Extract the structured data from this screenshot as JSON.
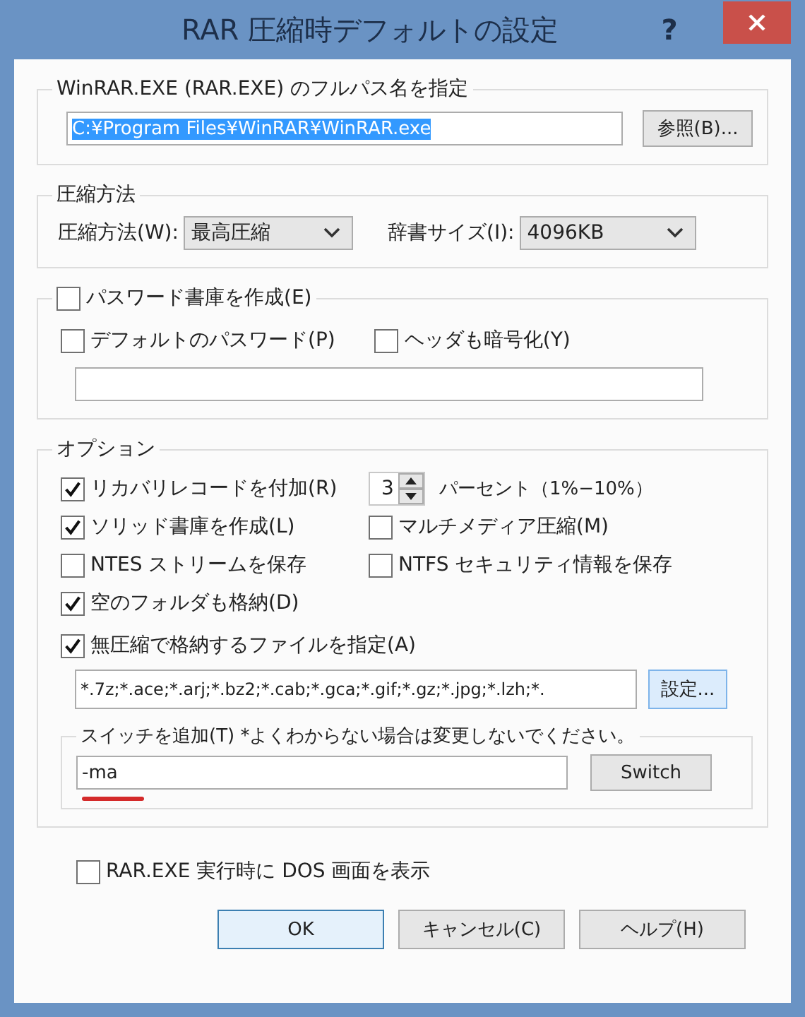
{
  "window": {
    "title": "RAR 圧縮時デフォルトの設定",
    "help": "?"
  },
  "path_group": {
    "label": "WinRAR.EXE (RAR.EXE) のフルパス名を指定",
    "value": "C:¥Program Files¥WinRAR¥WinRAR.exe",
    "selected": true,
    "browse_button": "参照(B)..."
  },
  "method_group": {
    "label": "圧縮方法",
    "method_label": "圧縮方法(W):",
    "method_value": "最高圧縮",
    "dict_label": "辞書サイズ(I):",
    "dict_value": "4096KB"
  },
  "password_group": {
    "label": "パスワード書庫を作成(E)",
    "checked": false,
    "options": [
      {
        "label": "デフォルトのパスワード(P)",
        "checked": false
      },
      {
        "label": "ヘッダも暗号化(Y)",
        "checked": false
      }
    ]
  },
  "options_group": {
    "label": "オプション",
    "recovery": {
      "label": "リカバリレコードを付加(R)",
      "checked": true
    },
    "recovery_percent": "3",
    "percent_label": "パーセント（1%−10%）",
    "checks": [
      {
        "label": "ソリッド書庫を作成(L)",
        "checked": true
      },
      {
        "label": "マルチメディア圧縮(M)",
        "checked": false
      },
      {
        "label": "NTES ストリームを保存",
        "checked": false
      },
      {
        "label": "NTFS セキュリティ情報を保存",
        "checked": false
      },
      {
        "label": "空のフォルダも格納(D)",
        "checked": true
      }
    ],
    "store": {
      "label": "無圧縮で格納するファイルを指定(A)",
      "checked": true
    },
    "store_list": "*.7z;*.ace;*.arj;*.bz2;*.cab;*.gca;*.gif;*.gz;*.jpg;*.lzh;*.",
    "settings_button": "設定...",
    "switch_group": {
      "label": "スイッチを追加(T)  *よくわからない場合は変更しないでください。",
      "value": "-ma",
      "button": "Switch"
    }
  },
  "show_dos": {
    "label": "RAR.EXE 実行時に DOS 画面を表示",
    "checked": false
  },
  "buttons": [
    {
      "label": "OK",
      "default": true
    },
    {
      "label": "キャンセル(C)",
      "default": false
    },
    {
      "label": "ヘルプ(H)",
      "default": false
    }
  ]
}
